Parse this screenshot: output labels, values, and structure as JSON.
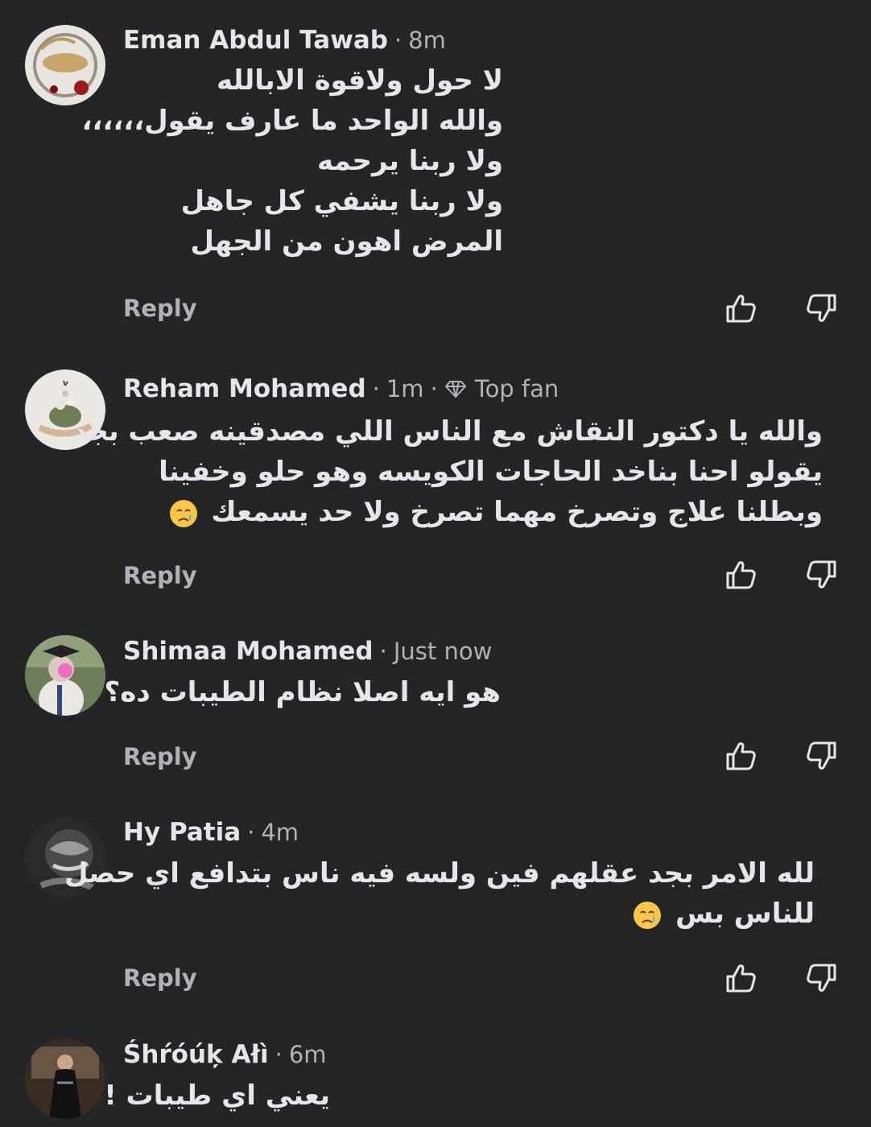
{
  "comments": [
    {
      "author": "Eman Abdul Tawab",
      "time": "8m",
      "lines": [
        "لا حول ولاقوة الابالله",
        "والله الواحد ما عارف يقول،،،،،،",
        "ولا ربنا يرحمه",
        "ولا ربنا يشفي كل جاهل",
        "المرض اهون من الجهل"
      ],
      "reply_label": "Reply"
    },
    {
      "author": "Reham Mohamed",
      "time": "1m",
      "badge": "Top fan",
      "lines": [
        "والله يا دكتور النقاش مع الناس اللي مصدقينه صعب بجد",
        "يقولو احنا بناخد الحاجات الكويسه وهو حلو وخفينا",
        "وبطلنا علاج وتصرخ مهما تصرخ ولا حد يسمعك"
      ],
      "reply_label": "Reply"
    },
    {
      "author": "Shimaa Mohamed",
      "time": "Just now",
      "lines": [
        "هو ايه اصلا نظام الطيبات ده؟"
      ],
      "reply_label": "Reply"
    },
    {
      "author": "Hy Patia",
      "time": "4m",
      "lines": [
        "لله الامر بجد عقلهم فين ولسه فيه ناس بتدافع اي حصل",
        "للناس بس"
      ],
      "reply_label": "Reply"
    },
    {
      "author": "Śhŕóúķ Ałì",
      "time": "6m",
      "lines": [
        "يعني اي طيبات !"
      ]
    }
  ],
  "icons": {
    "like": "thumbs-up-icon",
    "dislike": "thumbs-down-icon",
    "badge": "diamond-icon",
    "emoji": "crying-face-emoji"
  },
  "colors": {
    "background": "#242526",
    "primary_text": "#e4e6eb",
    "secondary_text": "#b0b3b8"
  }
}
